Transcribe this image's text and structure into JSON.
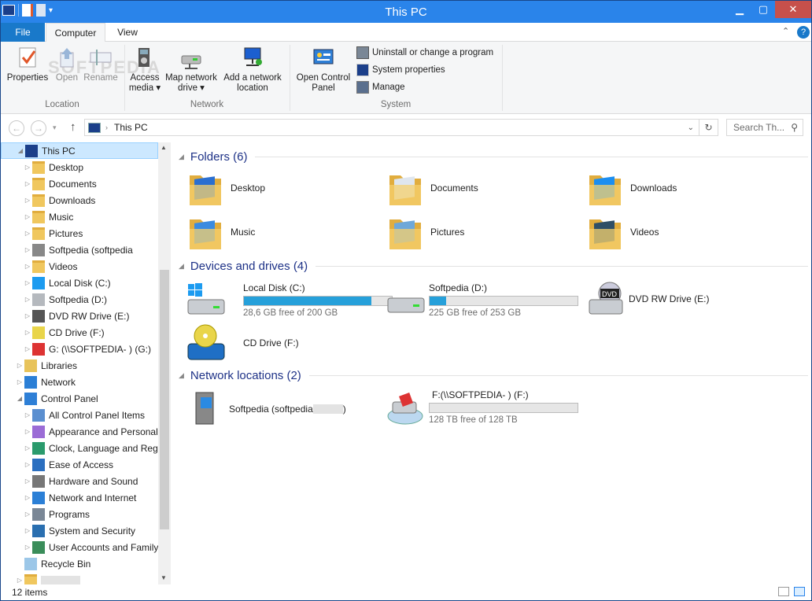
{
  "window": {
    "title": "This PC"
  },
  "tabs": {
    "file": "File",
    "computer": "Computer",
    "view": "View"
  },
  "ribbon": {
    "location": {
      "label": "Location",
      "properties": "Properties",
      "open": "Open",
      "rename": "Rename"
    },
    "network": {
      "label": "Network",
      "access_media_1": "Access",
      "access_media_2": "media",
      "map_drive_1": "Map network",
      "map_drive_2": "drive",
      "add_location_1": "Add a network",
      "add_location_2": "location"
    },
    "system": {
      "label": "System",
      "open_cp_1": "Open Control",
      "open_cp_2": "Panel",
      "uninstall": "Uninstall or change a program",
      "sys_props": "System properties",
      "manage": "Manage"
    },
    "watermark": "SOFTPEDIA"
  },
  "address": {
    "path": "This PC",
    "search_placeholder": "Search Th..."
  },
  "tree": [
    {
      "label": "This PC",
      "indent": 0,
      "exp": "◢",
      "icon": "pc-icon",
      "selected": true
    },
    {
      "label": "Desktop",
      "indent": 1,
      "exp": "▷",
      "icon": "folder-desktop-icon"
    },
    {
      "label": "Documents",
      "indent": 1,
      "exp": "▷",
      "icon": "folder-documents-icon"
    },
    {
      "label": "Downloads",
      "indent": 1,
      "exp": "▷",
      "icon": "folder-downloads-icon"
    },
    {
      "label": "Music",
      "indent": 1,
      "exp": "▷",
      "icon": "folder-music-icon"
    },
    {
      "label": "Pictures",
      "indent": 1,
      "exp": "▷",
      "icon": "folder-pictures-icon"
    },
    {
      "label": "Softpedia (softpedia",
      "indent": 1,
      "exp": "▷",
      "icon": "network-share-icon"
    },
    {
      "label": "Videos",
      "indent": 1,
      "exp": "▷",
      "icon": "folder-videos-icon"
    },
    {
      "label": "Local Disk (C:)",
      "indent": 1,
      "exp": "▷",
      "icon": "windows-drive-icon"
    },
    {
      "label": "Softpedia (D:)",
      "indent": 1,
      "exp": "▷",
      "icon": "drive-icon"
    },
    {
      "label": "DVD RW Drive (E:)",
      "indent": 1,
      "exp": "▷",
      "icon": "dvd-drive-icon"
    },
    {
      "label": "CD Drive (F:)",
      "indent": 1,
      "exp": "▷",
      "icon": "cd-drive-icon"
    },
    {
      "label": "G: (\\\\SOFTPEDIA-      ) (G:)",
      "indent": 1,
      "exp": "▷",
      "icon": "network-drive-icon"
    },
    {
      "label": "Libraries",
      "indent": 0,
      "exp": "▷",
      "icon": "libraries-icon"
    },
    {
      "label": "Network",
      "indent": 0,
      "exp": "▷",
      "icon": "network-icon"
    },
    {
      "label": "Control Panel",
      "indent": 0,
      "exp": "◢",
      "icon": "control-panel-icon"
    },
    {
      "label": "All Control Panel Items",
      "indent": 1,
      "exp": "▷",
      "icon": "cp-items-icon"
    },
    {
      "label": "Appearance and Personali",
      "indent": 1,
      "exp": "▷",
      "icon": "appearance-icon"
    },
    {
      "label": "Clock, Language and Regi",
      "indent": 1,
      "exp": "▷",
      "icon": "clock-icon"
    },
    {
      "label": "Ease of Access",
      "indent": 1,
      "exp": "▷",
      "icon": "ease-access-icon"
    },
    {
      "label": "Hardware and Sound",
      "indent": 1,
      "exp": "▷",
      "icon": "hardware-icon"
    },
    {
      "label": "Network and Internet",
      "indent": 1,
      "exp": "▷",
      "icon": "network-internet-icon"
    },
    {
      "label": "Programs",
      "indent": 1,
      "exp": "▷",
      "icon": "programs-icon"
    },
    {
      "label": "System and Security",
      "indent": 1,
      "exp": "▷",
      "icon": "security-icon"
    },
    {
      "label": "User Accounts and Family",
      "indent": 1,
      "exp": "▷",
      "icon": "users-icon"
    },
    {
      "label": "Recycle Bin",
      "indent": 0,
      "exp": "",
      "icon": "recycle-bin-icon"
    },
    {
      "label": "",
      "indent": 0,
      "exp": "▷",
      "icon": "folder-icon"
    }
  ],
  "content": {
    "folders_header": "Folders (6)",
    "devices_header": "Devices and drives (4)",
    "network_header": "Network locations (2)",
    "folders": [
      "Desktop",
      "Documents",
      "Downloads",
      "Music",
      "Pictures",
      "Videos"
    ],
    "drives": [
      {
        "name": "Local Disk (C:)",
        "free": "28,6 GB free of 200 GB",
        "used_pct": 86
      },
      {
        "name": "Softpedia (D:)",
        "free": "225 GB free of 253 GB",
        "used_pct": 11
      },
      {
        "name": "DVD RW Drive (E:)",
        "dvd_badge": "DVD"
      },
      {
        "name": "CD Drive (F:)"
      }
    ],
    "network": [
      {
        "name": "Softpedia (softpedia"
      },
      {
        "name": "F:(\\\\SOFTPEDIA-      ) (F:)",
        "free": "128 TB free of 128 TB",
        "used_pct": 0
      }
    ]
  },
  "status": {
    "items": "12 items"
  }
}
